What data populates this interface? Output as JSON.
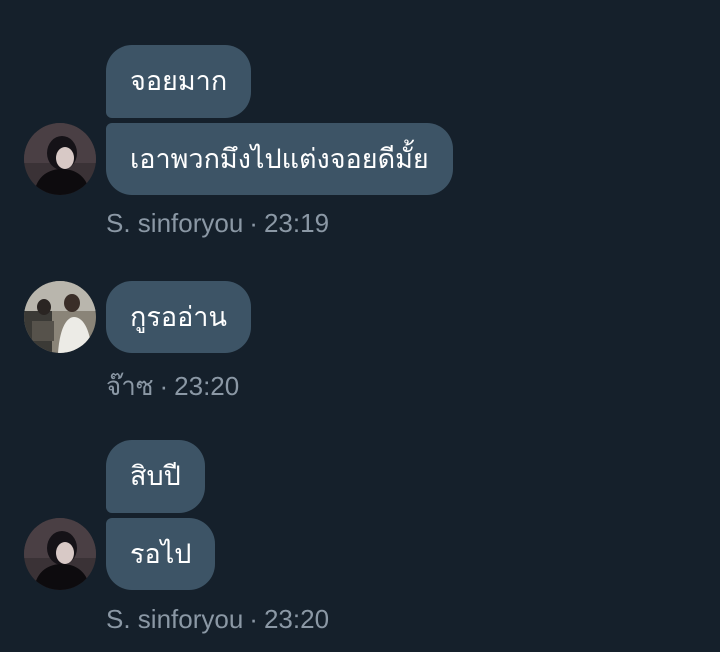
{
  "colors": {
    "background": "#15202b",
    "bubble": "#3d5466",
    "bubble_text": "#ffffff",
    "meta_text": "#8b98a5"
  },
  "messages": [
    {
      "sender": "S. sinforyou",
      "time": "23:19",
      "bubbles": [
        "จอยมาก",
        "เอาพวกมึงไปแต่งจอยดีมั้ย"
      ],
      "avatar_icon": "user-photo-dark-hoodie"
    },
    {
      "sender": "จ๊าซ",
      "time": "23:20",
      "bubbles": [
        "กูรออ่าน"
      ],
      "avatar_icon": "user-photo-group"
    },
    {
      "sender": "S. sinforyou",
      "time": "23:20",
      "bubbles": [
        "สิบปี",
        "รอไป"
      ],
      "avatar_icon": "user-photo-dark-hoodie"
    }
  ],
  "meta_separator": "·"
}
